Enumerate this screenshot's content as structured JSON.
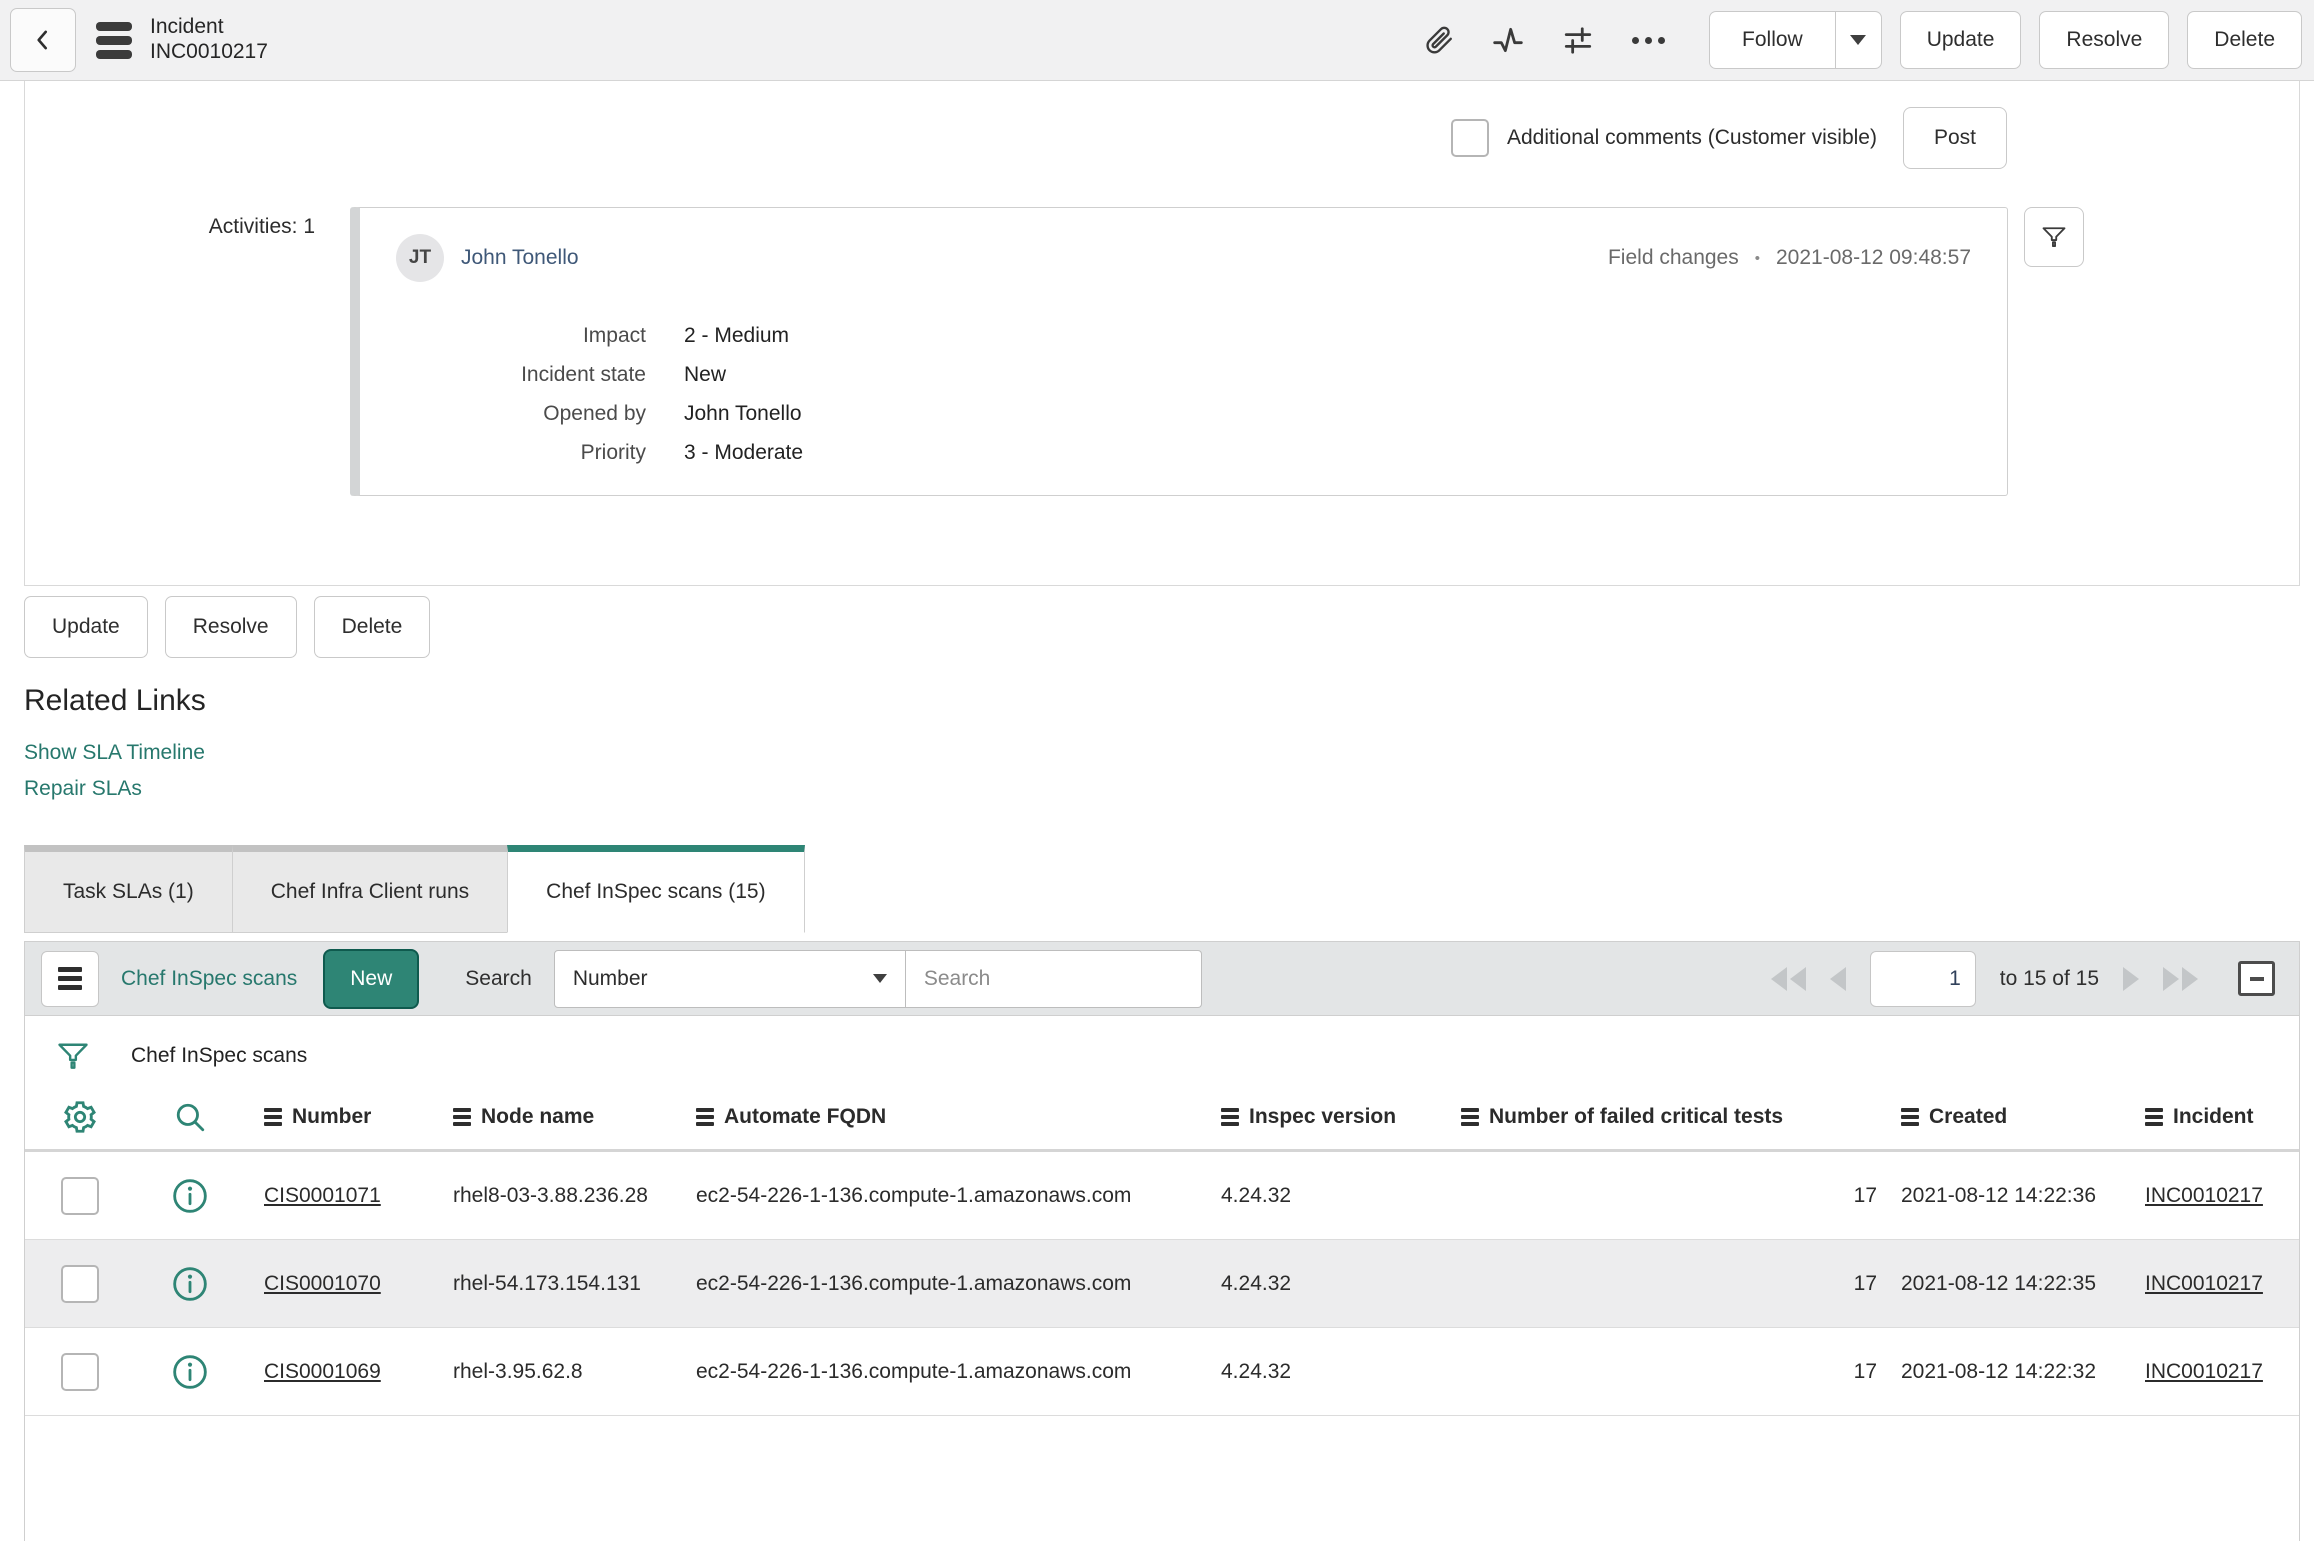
{
  "colors": {
    "accent_teal": "#2E8575",
    "accent_teal_dark": "#0F5A4E",
    "link_teal": "#27786D",
    "header_bg": "#F1F1F2",
    "toolbar_bg": "#E3E5E6",
    "row_alt_bg": "#EDEDEE",
    "border_gray": "#CFCFCF"
  },
  "header": {
    "title_line1": "Incident",
    "title_line2": "INC0010217",
    "icons": [
      "back-chevron",
      "context-menu",
      "attachment",
      "activity-stream",
      "personalize-form",
      "more-options"
    ],
    "follow_label": "Follow",
    "update_label": "Update",
    "resolve_label": "Resolve",
    "delete_label": "Delete"
  },
  "comments": {
    "checkbox_checked": false,
    "label": "Additional comments (Customer visible)",
    "post_label": "Post"
  },
  "activities": {
    "count_label": "Activities: 1",
    "filter_icon": "funnel",
    "entries": [
      {
        "avatar_initials": "JT",
        "author": "John Tonello",
        "meta_type": "Field changes",
        "meta_separator": "•",
        "meta_time": "2021-08-12 09:48:57",
        "fields": [
          {
            "label": "Impact",
            "value": "2 - Medium"
          },
          {
            "label": "Incident state",
            "value": "New"
          },
          {
            "label": "Opened by",
            "value": "John Tonello"
          },
          {
            "label": "Priority",
            "value": "3 - Moderate"
          }
        ]
      }
    ]
  },
  "form_actions": {
    "update": "Update",
    "resolve": "Resolve",
    "delete": "Delete"
  },
  "related_links": {
    "title": "Related Links",
    "links": [
      "Show SLA Timeline",
      "Repair SLAs"
    ]
  },
  "tabs": [
    {
      "label": "Task SLAs (1)",
      "active": false
    },
    {
      "label": "Chef Infra Client runs",
      "active": false
    },
    {
      "label": "Chef InSpec scans (15)",
      "active": true
    }
  ],
  "list": {
    "title": "Chef InSpec scans",
    "new_label": "New",
    "search_label": "Search",
    "search_field": "Number",
    "search_placeholder": "Search",
    "pagination": {
      "page_value": "1",
      "range_text": "to 15 of 15"
    },
    "breadcrumb_title": "Chef InSpec scans",
    "icons": [
      "list-context-menu",
      "filter-funnel",
      "personalize-list-gear",
      "column-search-magnifier",
      "row-info"
    ],
    "columns": [
      "Number",
      "Node name",
      "Automate FQDN",
      "Inspec version",
      "Number of failed critical tests",
      "Created",
      "Incident"
    ],
    "rows": [
      {
        "number": "CIS0001071",
        "node_name": "rhel8-03-3.88.236.28",
        "automate_fqdn": "ec2-54-226-1-136.compute-1.amazonaws.com",
        "inspec_version": "4.24.32",
        "failed_critical": "17",
        "created": "2021-08-12 14:22:36",
        "incident": "INC0010217"
      },
      {
        "number": "CIS0001070",
        "node_name": "rhel-54.173.154.131",
        "automate_fqdn": "ec2-54-226-1-136.compute-1.amazonaws.com",
        "inspec_version": "4.24.32",
        "failed_critical": "17",
        "created": "2021-08-12 14:22:35",
        "incident": "INC0010217"
      },
      {
        "number": "CIS0001069",
        "node_name": "rhel-3.95.62.8",
        "automate_fqdn": "ec2-54-226-1-136.compute-1.amazonaws.com",
        "inspec_version": "4.24.32",
        "failed_critical": "17",
        "created": "2021-08-12 14:22:32",
        "incident": "INC0010217"
      }
    ]
  }
}
